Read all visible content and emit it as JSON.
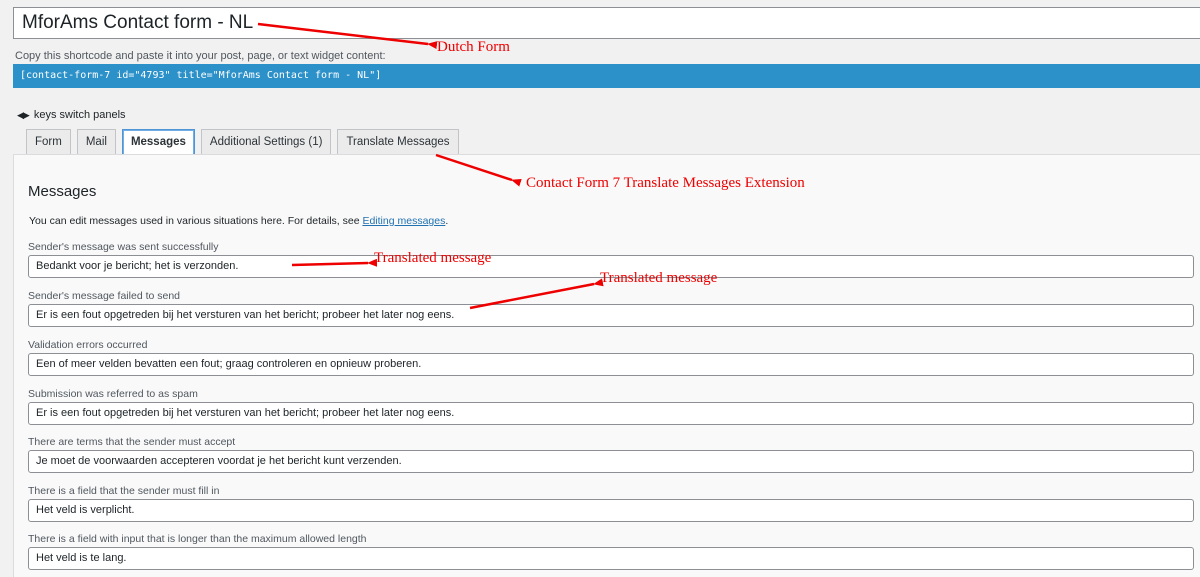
{
  "form": {
    "title": "MforAms Contact form - NL",
    "shortcode_hint": "Copy this shortcode and paste it into your post, page, or text widget content:",
    "shortcode": "[contact-form-7 id=\"4793\" title=\"MforAms Contact form - NL\"]",
    "keys_hint": "keys switch panels"
  },
  "tabs": [
    {
      "label": "Form",
      "active": false
    },
    {
      "label": "Mail",
      "active": false
    },
    {
      "label": "Messages",
      "active": true
    },
    {
      "label": "Additional Settings (1)",
      "active": false
    },
    {
      "label": "Translate Messages",
      "active": false
    }
  ],
  "panel": {
    "title": "Messages",
    "desc_prefix": "You can edit messages used in various situations here. For details, see ",
    "desc_link": "Editing messages",
    "desc_suffix": "."
  },
  "messages": [
    {
      "label": "Sender's message was sent successfully",
      "value": "Bedankt voor je bericht; het is verzonden."
    },
    {
      "label": "Sender's message failed to send",
      "value": "Er is een fout opgetreden bij het versturen van het bericht; probeer het later nog eens."
    },
    {
      "label": "Validation errors occurred",
      "value": "Een of meer velden bevatten een fout; graag controleren en opnieuw proberen."
    },
    {
      "label": "Submission was referred to as spam",
      "value": "Er is een fout opgetreden bij het versturen van het bericht; probeer het later nog eens."
    },
    {
      "label": "There are terms that the sender must accept",
      "value": "Je moet de voorwaarden accepteren voordat je het bericht kunt verzenden."
    },
    {
      "label": "There is a field that the sender must fill in",
      "value": "Het veld is verplicht."
    },
    {
      "label": "There is a field with input that is longer than the maximum allowed length",
      "value": "Het veld is te lang."
    }
  ],
  "annotations": {
    "dutch_form": "Dutch Form",
    "extension": "Contact Form 7 Translate Messages Extension",
    "translated_1": "Translated message",
    "translated_2": "Translated message",
    "color": "#e00000"
  },
  "colors": {
    "shortcode_bg": "#2c90c9",
    "link": "#2271b1",
    "active_tab_border": "#4f94d4"
  }
}
